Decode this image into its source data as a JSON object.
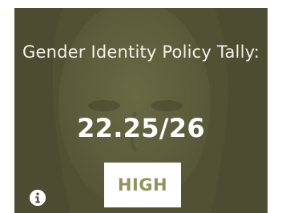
{
  "card": {
    "title": "Gender Identity Policy Tally:",
    "score": "22.25/26",
    "rating": "HIGH",
    "info_icon": "info-circle-icon",
    "colors": {
      "overlay": "#535536",
      "title_text": "#f3f2e8",
      "score_text": "#ffffff",
      "badge_bg": "#ffffff",
      "badge_text": "#93935d"
    }
  }
}
